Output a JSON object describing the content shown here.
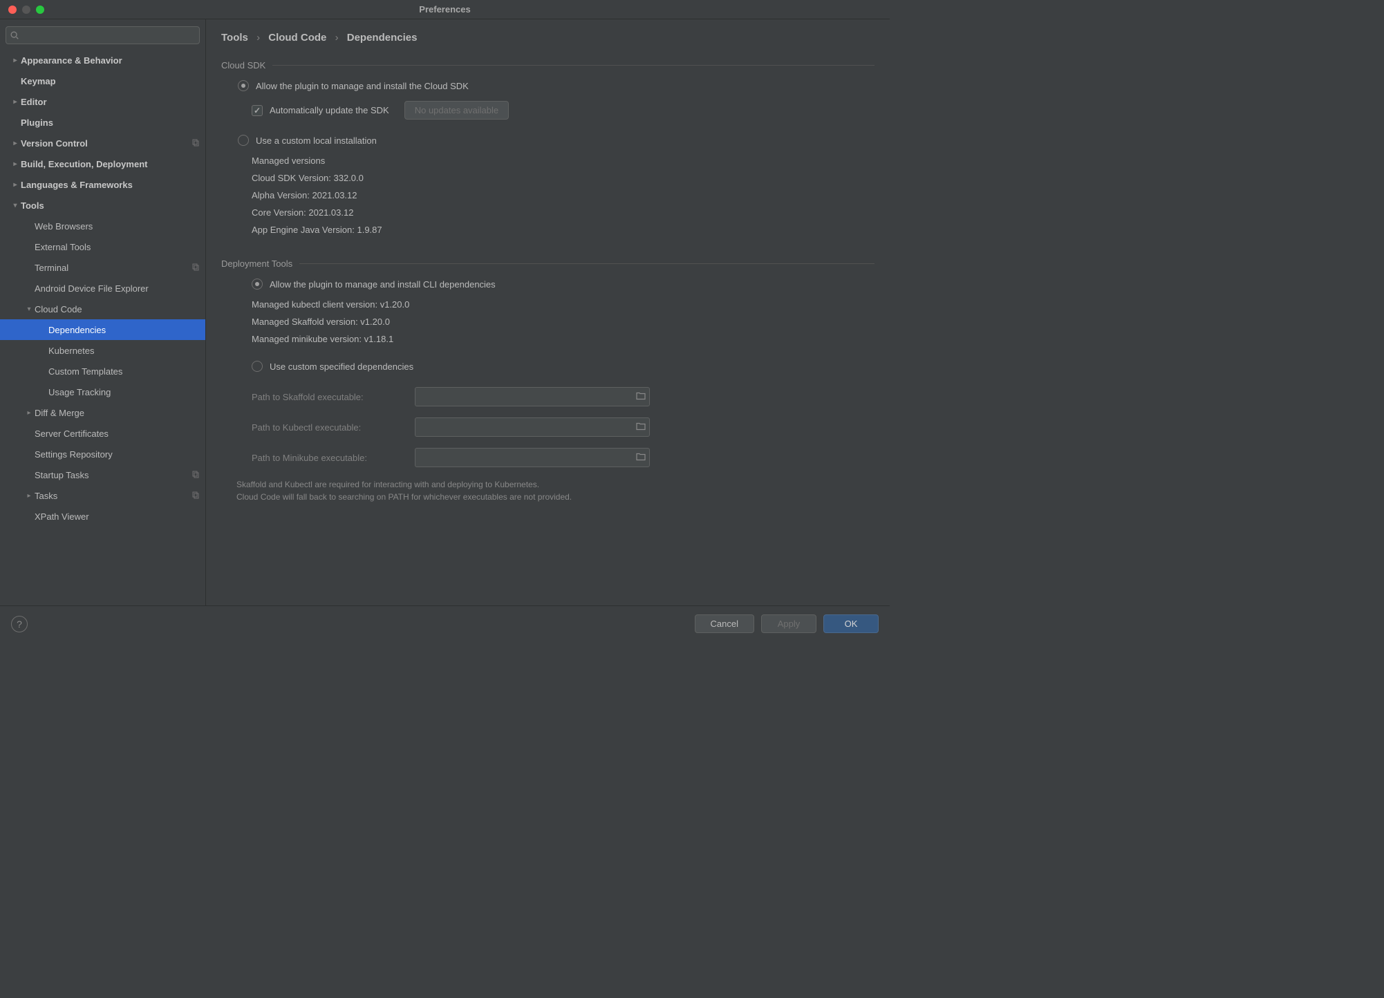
{
  "window": {
    "title": "Preferences"
  },
  "search": {
    "placeholder": ""
  },
  "sidebar": {
    "items": [
      {
        "label": "Appearance & Behavior",
        "arrow": "right",
        "bold": true,
        "indent": 0
      },
      {
        "label": "Keymap",
        "arrow": "",
        "bold": true,
        "indent": 0
      },
      {
        "label": "Editor",
        "arrow": "right",
        "bold": true,
        "indent": 0
      },
      {
        "label": "Plugins",
        "arrow": "",
        "bold": true,
        "indent": 0
      },
      {
        "label": "Version Control",
        "arrow": "right",
        "bold": true,
        "indent": 0,
        "copy": true
      },
      {
        "label": "Build, Execution, Deployment",
        "arrow": "right",
        "bold": true,
        "indent": 0
      },
      {
        "label": "Languages & Frameworks",
        "arrow": "right",
        "bold": true,
        "indent": 0
      },
      {
        "label": "Tools",
        "arrow": "down",
        "bold": true,
        "indent": 0
      },
      {
        "label": "Web Browsers",
        "arrow": "",
        "bold": false,
        "indent": 1
      },
      {
        "label": "External Tools",
        "arrow": "",
        "bold": false,
        "indent": 1
      },
      {
        "label": "Terminal",
        "arrow": "",
        "bold": false,
        "indent": 1,
        "copy": true
      },
      {
        "label": "Android Device File Explorer",
        "arrow": "",
        "bold": false,
        "indent": 1
      },
      {
        "label": "Cloud Code",
        "arrow": "down",
        "bold": false,
        "indent": 1
      },
      {
        "label": "Dependencies",
        "arrow": "",
        "bold": false,
        "indent": 2,
        "selected": true
      },
      {
        "label": "Kubernetes",
        "arrow": "",
        "bold": false,
        "indent": 2
      },
      {
        "label": "Custom Templates",
        "arrow": "",
        "bold": false,
        "indent": 2
      },
      {
        "label": "Usage Tracking",
        "arrow": "",
        "bold": false,
        "indent": 2
      },
      {
        "label": "Diff & Merge",
        "arrow": "right",
        "bold": false,
        "indent": 1
      },
      {
        "label": "Server Certificates",
        "arrow": "",
        "bold": false,
        "indent": 1
      },
      {
        "label": "Settings Repository",
        "arrow": "",
        "bold": false,
        "indent": 1
      },
      {
        "label": "Startup Tasks",
        "arrow": "",
        "bold": false,
        "indent": 1,
        "copy": true
      },
      {
        "label": "Tasks",
        "arrow": "right",
        "bold": false,
        "indent": 1,
        "copy": true
      },
      {
        "label": "XPath Viewer",
        "arrow": "",
        "bold": false,
        "indent": 1
      }
    ]
  },
  "breadcrumb": {
    "p0": "Tools",
    "p1": "Cloud Code",
    "p2": "Dependencies"
  },
  "cloudSdk": {
    "sectionTitle": "Cloud SDK",
    "radioManage": "Allow the plugin to manage and install the Cloud SDK",
    "autoUpdate": "Automatically update the SDK",
    "noUpdatesBtn": "No updates available",
    "radioCustom": "Use a custom local installation",
    "managedVersions": "Managed versions",
    "lines": [
      "Cloud SDK Version: 332.0.0",
      "Alpha Version: 2021.03.12",
      "Core Version: 2021.03.12",
      "App Engine Java Version: 1.9.87"
    ]
  },
  "deployTools": {
    "sectionTitle": "Deployment Tools",
    "radioManage": "Allow the plugin to manage and install CLI dependencies",
    "lines": [
      "Managed kubectl client version: v1.20.0",
      "Managed Skaffold version: v1.20.0",
      "Managed minikube version: v1.18.1"
    ],
    "radioCustom": "Use custom specified dependencies",
    "paths": [
      {
        "label": "Path to Skaffold executable:"
      },
      {
        "label": "Path to Kubectl executable:"
      },
      {
        "label": "Path to Minikube executable:"
      }
    ],
    "note1": "Skaffold and Kubectl are required for interacting with and deploying to Kubernetes.",
    "note2": "Cloud Code will fall back to searching on PATH for whichever executables are not provided."
  },
  "footer": {
    "cancel": "Cancel",
    "apply": "Apply",
    "ok": "OK"
  }
}
